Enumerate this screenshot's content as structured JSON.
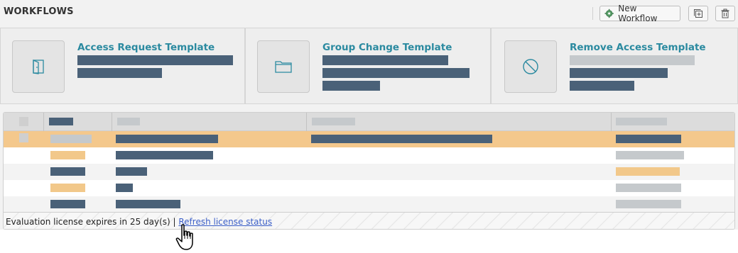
{
  "header": {
    "title": "WORKFLOWS",
    "new_workflow_label": "New Workflow",
    "icons": {
      "new": "gear-icon",
      "duplicate": "add-copy-icon",
      "delete": "trash-icon"
    }
  },
  "templates": [
    {
      "title": "Access Request Template",
      "icon": "door-icon"
    },
    {
      "title": "Group Change Template",
      "icon": "folder-icon"
    },
    {
      "title": "Remove Access Template",
      "icon": "prohibited-icon"
    }
  ],
  "grid": {
    "selected_row": 0,
    "row_count": 5
  },
  "footer": {
    "status_text": "Evaluation license expires in 25 day(s) | ",
    "link_text": "Refresh license status"
  },
  "colors": {
    "accent": "#2b8aa0",
    "redacted_dark": "#4a6178",
    "redacted_light": "#c5c9cc",
    "selection": "#f4c88c",
    "link": "#3b5fc8"
  }
}
